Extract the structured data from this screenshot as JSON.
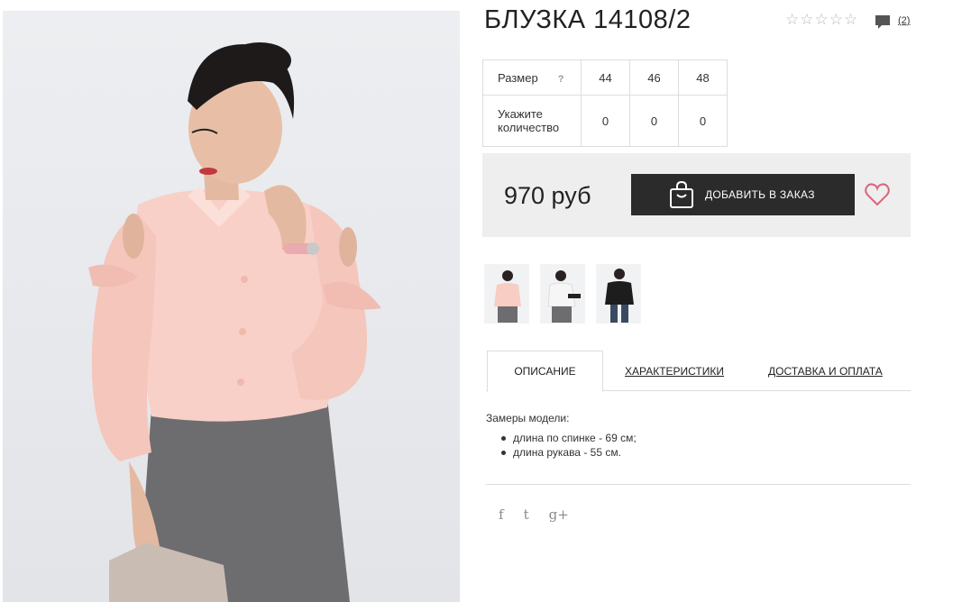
{
  "product": {
    "title": "БЛУЗКА 14108/2",
    "rating_stars": [
      "☆",
      "☆",
      "☆",
      "☆",
      "☆"
    ],
    "reviews_link": "(2)",
    "price": "970 руб",
    "add_to_order": "ДОБАВИТЬ В ЗАКАЗ"
  },
  "size_table": {
    "size_label": "Размер",
    "help_mark": "?",
    "sizes": [
      "44",
      "46",
      "48"
    ],
    "qty_label": "Укажите количество",
    "quantities": [
      "0",
      "0",
      "0"
    ]
  },
  "tabs": [
    "ОПИСАНИЕ",
    "ХАРАКТЕРИСТИКИ",
    "ДОСТАВКА И ОПЛАТА"
  ],
  "description": {
    "heading": "Замеры модели:",
    "items": [
      "длина по спинке - 69 см;",
      "длина рукава - 55 см."
    ]
  },
  "social": {
    "facebook": "f",
    "twitter": "t",
    "google": "g+"
  },
  "colors": {
    "button_bg": "#2b2b2b",
    "price_box_bg": "#eeeeee",
    "heart": "#d9667a",
    "blouse": "#f7cdc4",
    "skirt": "#6b6b6b"
  },
  "icons": [
    "star-icon",
    "comment-icon",
    "bag-icon",
    "heart-icon",
    "facebook-icon",
    "twitter-icon",
    "google-plus-icon"
  ]
}
